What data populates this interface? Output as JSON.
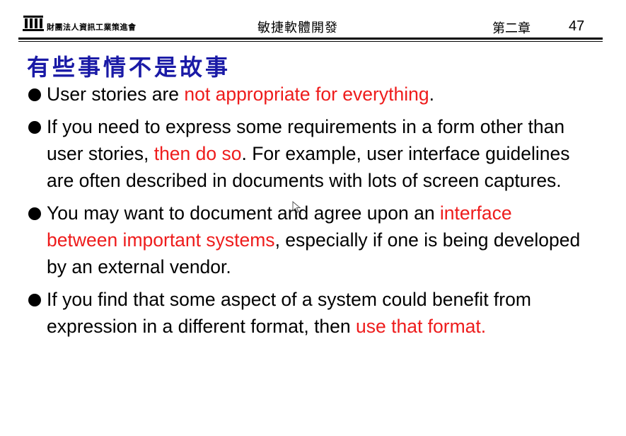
{
  "header": {
    "organization": "財團法人資訊工業策進會",
    "course_title": "敏捷軟體開發",
    "chapter": "第二章",
    "page_number": "47",
    "logo_icon": "institution-pillars-icon"
  },
  "slide": {
    "title": "有些事情不是故事",
    "title_color": "#1a1aa6",
    "highlight_color": "#ee1c1c",
    "bullets": [
      {
        "parts": [
          {
            "text": "User stories are ",
            "highlight": false
          },
          {
            "text": "not appropriate for everything",
            "highlight": true
          },
          {
            "text": ".",
            "highlight": false
          }
        ]
      },
      {
        "parts": [
          {
            "text": "If you need to express some requirements in a form other than user stories, ",
            "highlight": false
          },
          {
            "text": "then do so",
            "highlight": true
          },
          {
            "text": ". For example, user interface guidelines are often described in documents with lots of screen captures.",
            "highlight": false
          }
        ]
      },
      {
        "parts": [
          {
            "text": "You may want to document and agree upon an ",
            "highlight": false
          },
          {
            "text": "interface between important systems",
            "highlight": true
          },
          {
            "text": ", especially if one is being developed by an external vendor.",
            "highlight": false
          }
        ]
      },
      {
        "parts": [
          {
            "text": "If you find that some aspect of a system could benefit from expression in a different format, then ",
            "highlight": false
          },
          {
            "text": "use that format.",
            "highlight": true
          }
        ]
      }
    ]
  }
}
